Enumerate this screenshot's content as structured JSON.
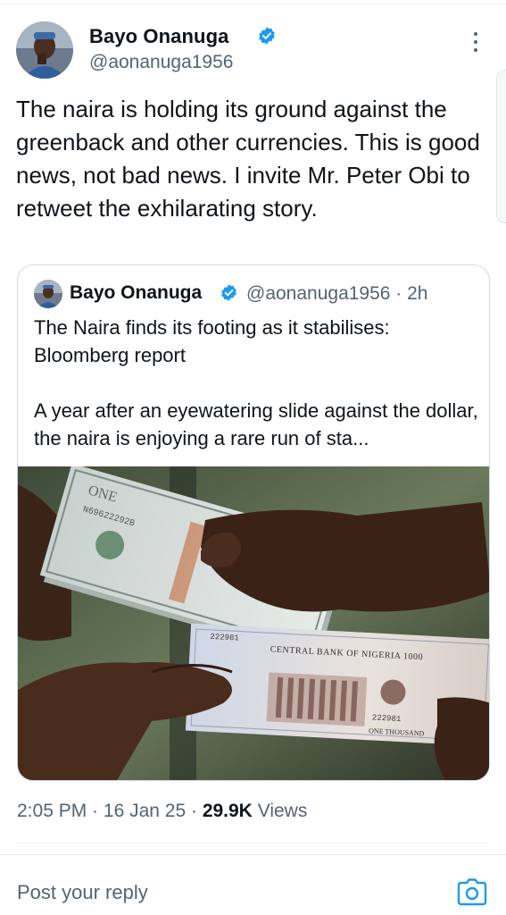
{
  "post": {
    "author_name": "Bayo Onanuga",
    "author_handle": "@aonanuga1956",
    "text": "The naira is holding its ground against the greenback and other currencies. This is good news, not bad news. I invite Mr. Peter Obi to retweet the exhilarating story."
  },
  "quoted": {
    "author_name": "Bayo Onanuga",
    "handle_time": "@aonanuga1956 · 2h",
    "text": "The Naira finds its footing as it stabilises: Bloomberg report\n\nA year after an eyewatering slide against the dollar, the naira is enjoying a rare run of sta...",
    "image": {
      "usd_note_text": "ONE",
      "usd_serial": "N69622292B",
      "ngn_bank_text": "CENTRAL BANK OF NIGERIA 1000",
      "ngn_serial": "222981",
      "ngn_value_text": "ONE THOUSAND"
    }
  },
  "meta": {
    "time": "2:05 PM",
    "date": "16 Jan 25",
    "sep": " · ",
    "views_count": "29.9K",
    "views_label": "Views"
  },
  "reply": {
    "placeholder": "Post your reply"
  },
  "icons": {
    "verified": "verified-badge-icon",
    "more": "more-options-icon",
    "camera": "camera-icon"
  },
  "colors": {
    "verified_blue": "#1d9bf0",
    "secondary_text": "#536471",
    "primary_text": "#0f1419",
    "border": "#cfd9de"
  }
}
